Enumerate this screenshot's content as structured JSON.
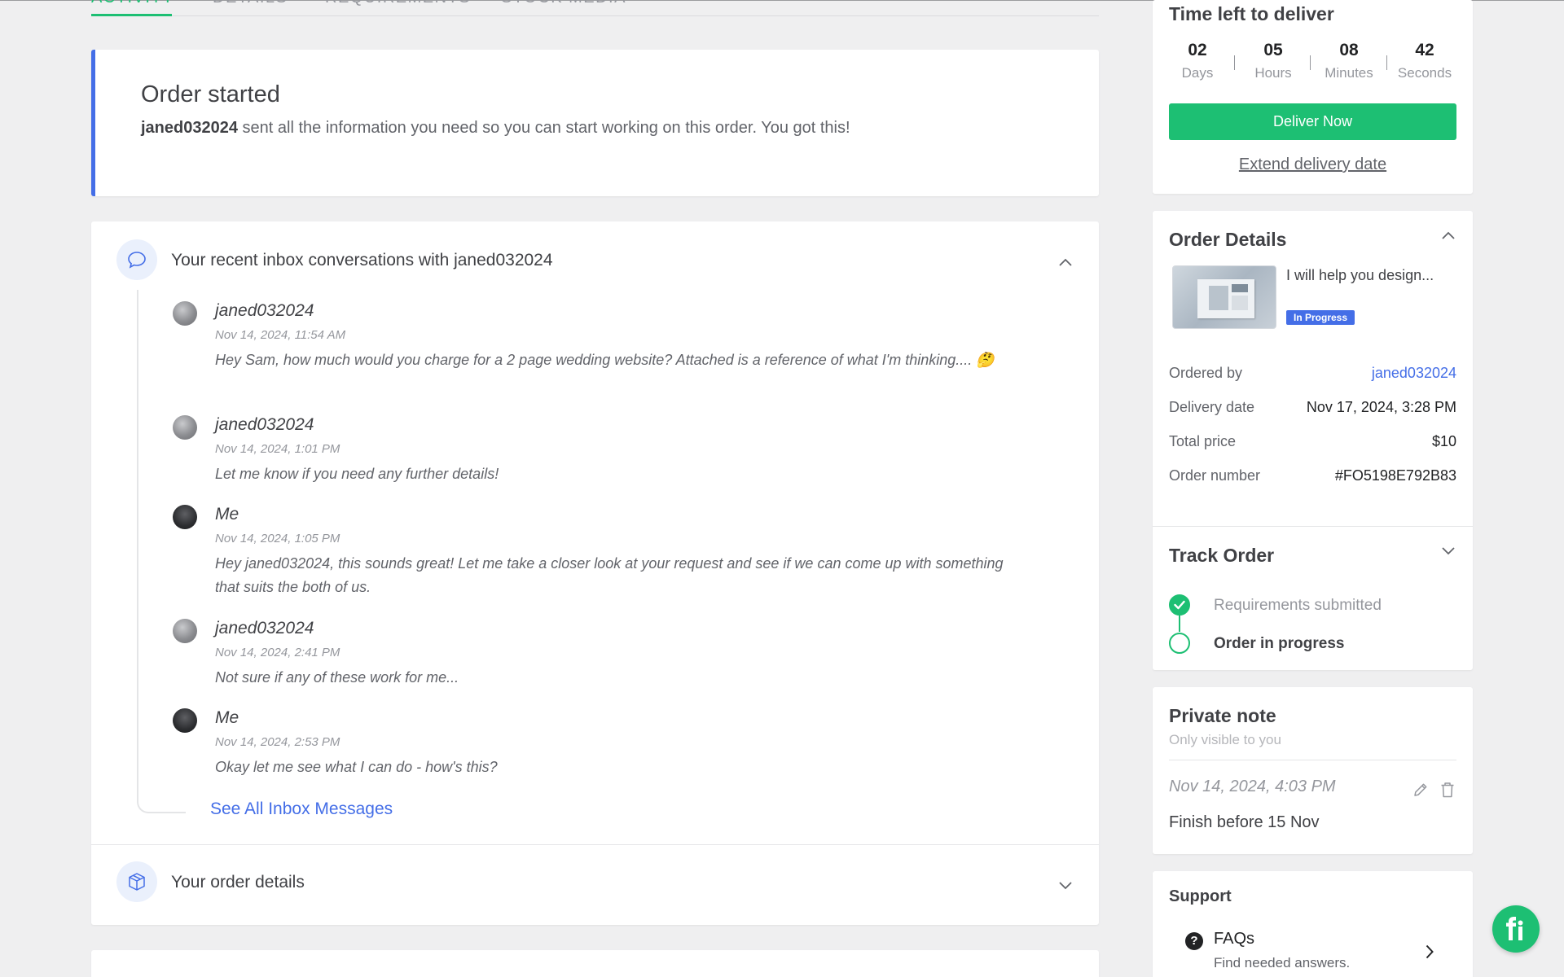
{
  "tabs": [
    {
      "label": "Activity",
      "active": true
    },
    {
      "label": "Details",
      "active": false
    },
    {
      "label": "Requirements",
      "active": false
    },
    {
      "label": "Stock Media",
      "active": false
    }
  ],
  "order_started": {
    "title": "Order started",
    "buyer": "janed032024",
    "message": "sent all the information you need so you can start working on this order. You got this!"
  },
  "conversations": {
    "title": "Your recent inbox conversations with janed032024",
    "messages": [
      {
        "sender": "janed032024",
        "time": "Nov 14, 2024, 11:54 AM",
        "text": "Hey Sam, how much would you charge for a 2 page wedding website? Attached is a reference of what I'm thinking.... 🤔",
        "avatar": "gray"
      },
      {
        "sender": "janed032024",
        "time": "Nov 14, 2024, 1:01 PM",
        "text": "Let me know if you need any further details!",
        "avatar": "gray"
      },
      {
        "sender": "Me",
        "time": "Nov 14, 2024, 1:05 PM",
        "text": "Hey janed032024, this sounds great! Let me take a closer look at your request and see if we can come up with something that suits the both of us.",
        "avatar": "me"
      },
      {
        "sender": "janed032024",
        "time": "Nov 14, 2024, 2:41 PM",
        "text": "Not sure if any of these work for me...",
        "avatar": "gray"
      },
      {
        "sender": "Me",
        "time": "Nov 14, 2024, 2:53 PM",
        "text": "Okay let me see what I can do - how's this?",
        "avatar": "me"
      }
    ],
    "see_all": "See All Inbox Messages"
  },
  "order_details_section": {
    "title": "Your order details"
  },
  "timer": {
    "title": "Time left to deliver",
    "units": [
      {
        "value": "02",
        "label": "Days"
      },
      {
        "value": "05",
        "label": "Hours"
      },
      {
        "value": "08",
        "label": "Minutes"
      },
      {
        "value": "42",
        "label": "Seconds"
      }
    ],
    "deliver_button": "Deliver Now",
    "extend_link": "Extend delivery date"
  },
  "order_details": {
    "title": "Order Details",
    "gig_title": "I will help you design...",
    "status_badge": "In Progress",
    "rows": [
      {
        "key": "Ordered by",
        "value": "janed032024"
      },
      {
        "key": "Delivery date",
        "value": "Nov 17, 2024, 3:28 PM"
      },
      {
        "key": "Total price",
        "value": "$10"
      },
      {
        "key": "Order number",
        "value": "#FO5198E792B83"
      }
    ]
  },
  "track_order": {
    "title": "Track Order",
    "steps": [
      {
        "label": "Requirements submitted",
        "done": true
      },
      {
        "label": "Order in progress",
        "done": false
      }
    ]
  },
  "private_note": {
    "title": "Private note",
    "subtitle": "Only visible to you",
    "date": "Nov 14, 2024, 4:03 PM",
    "text": "Finish before 15 Nov"
  },
  "support": {
    "title": "Support",
    "faq_title": "FAQs",
    "faq_subtitle": "Find needed answers."
  },
  "colors": {
    "accent_green": "#1dbf73",
    "link_blue": "#446ee7",
    "background": "#efeff0"
  }
}
